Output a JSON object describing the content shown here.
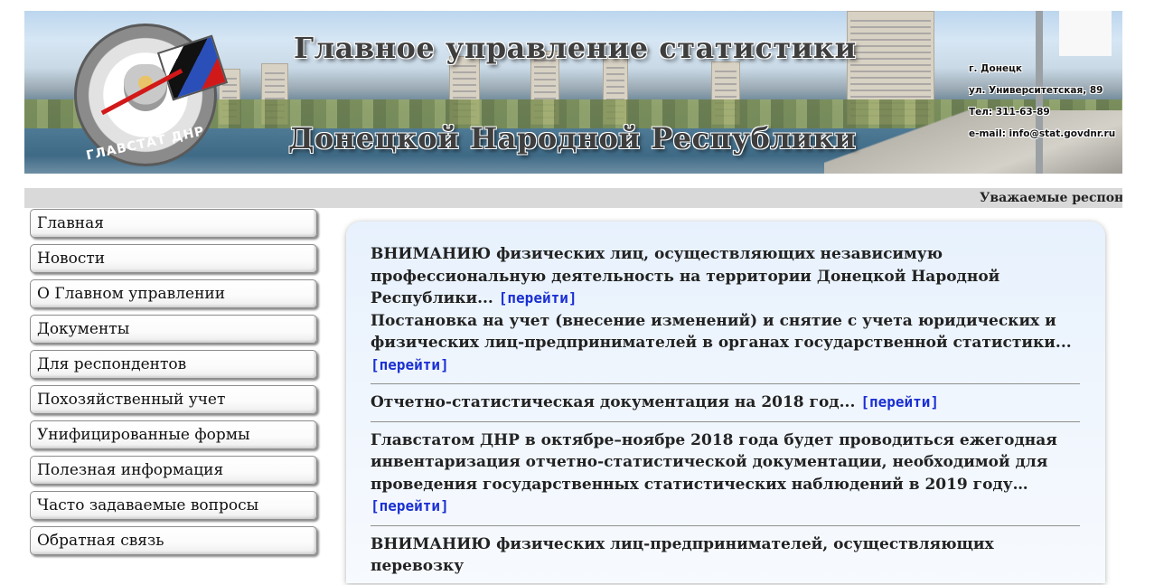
{
  "header": {
    "title_line1": "Главное управление статистики",
    "title_line2": "Донецкой Народной Республики",
    "logo_text": "ГЛАВСТАТ ДНР",
    "contacts": {
      "city": "г. Донецк",
      "street": "ул. Университетская, 89",
      "phone": "Тел: 311-63-89",
      "email": "e-mail: info@stat.govdnr.ru"
    }
  },
  "ticker": {
    "text": "Уважаемые респонд"
  },
  "menu": {
    "items": [
      {
        "label": "Главная"
      },
      {
        "label": "Новости"
      },
      {
        "label": "О Главном управлении"
      },
      {
        "label": "Документы"
      },
      {
        "label": "Для респондентов"
      },
      {
        "label": "Похозяйственный учет"
      },
      {
        "label": "Унифицированные формы"
      },
      {
        "label": "Полезная информация"
      },
      {
        "label": "Часто задаваемые вопросы"
      },
      {
        "label": "Обратная связь"
      }
    ]
  },
  "news": {
    "link_label": "[перейти]",
    "items": [
      {
        "text": "ВНИМАНИЮ физических лиц, осуществляющих независимую профессиональную деятельность на территории Донецкой Народной Республики..."
      },
      {
        "text": "Постановка на учет (внесение изменений) и снятие с учета юридических и физических лиц-предпринимателей в органах государственной статистики..."
      },
      {
        "text": "Отчетно-статистическая документация на 2018 год..."
      },
      {
        "text": "Главстатом ДНР в октябре–ноябре 2018 года будет проводиться ежегодная инвентаризация отчетно-статистической документации, необходимой для проведения государственных статистических наблюдений в 2019 году…"
      },
      {
        "text": "ВНИМАНИЮ физических лиц-предпринимателей, осуществляющих перевозку"
      }
    ]
  },
  "colors": {
    "link": "#1a2fd2",
    "ticker_bg": "#d9d9d9",
    "content_bg": "#e7f1fd"
  }
}
